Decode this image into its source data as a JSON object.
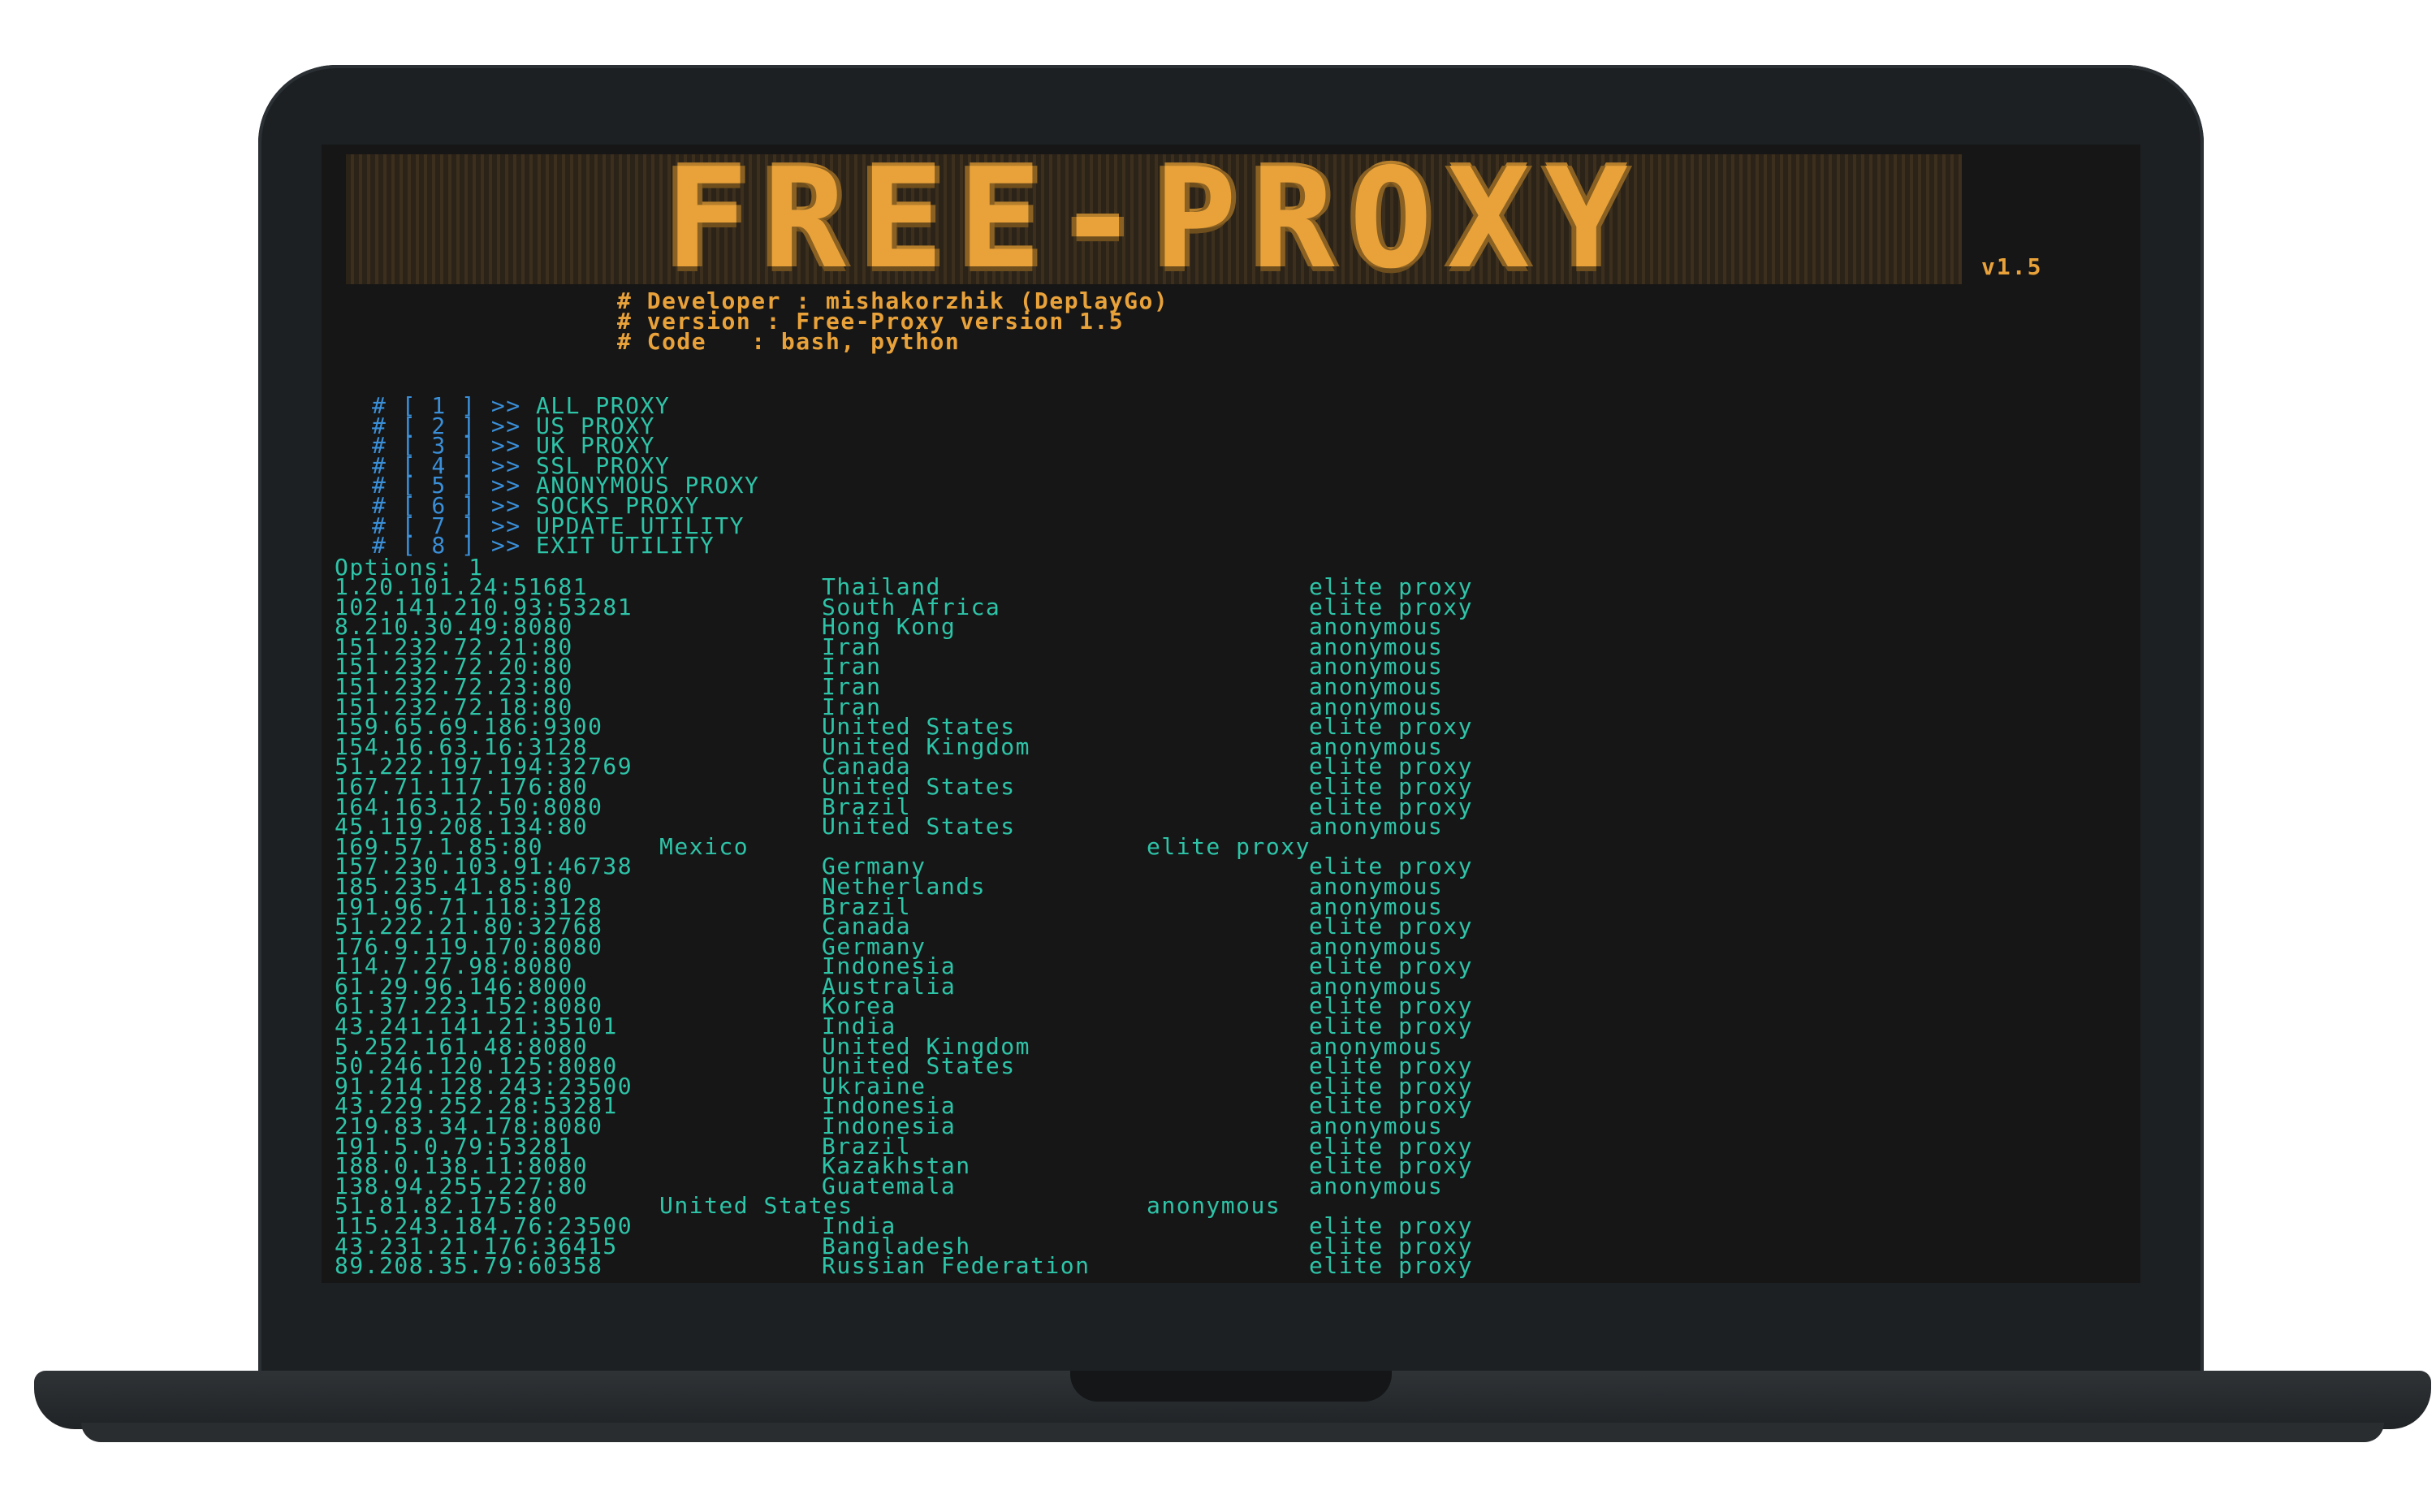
{
  "banner": {
    "title": "FREE-PROXY",
    "version_tag": "v1.5"
  },
  "info": {
    "developer": "# Developer : mishakorzhik (DeplayGo)",
    "version": "# version : Free-Proxy version 1.5",
    "code": "# Code   : bash, python"
  },
  "menu": [
    {
      "hash": "#",
      "num": "[ 1 ]",
      "arrow": ">>",
      "label": "ALL PROXY"
    },
    {
      "hash": "#",
      "num": "[ 2 ]",
      "arrow": ">>",
      "label": "US PROXY"
    },
    {
      "hash": "#",
      "num": "[ 3 ]",
      "arrow": ">>",
      "label": "UK PROXY"
    },
    {
      "hash": "#",
      "num": "[ 4 ]",
      "arrow": ">>",
      "label": "SSL PROXY"
    },
    {
      "hash": "#",
      "num": "[ 5 ]",
      "arrow": ">>",
      "label": "ANONYMOUS PROXY"
    },
    {
      "hash": "#",
      "num": "[ 6 ]",
      "arrow": ">>",
      "label": "SOCKS PROXY"
    },
    {
      "hash": "#",
      "num": "[ 7 ]",
      "arrow": ">>",
      "label": "UPDATE UTILITY"
    },
    {
      "hash": "#",
      "num": "[ 8 ]",
      "arrow": ">>",
      "label": "EXIT UTILITY"
    }
  ],
  "prompt": "Options: 1",
  "proxies": [
    {
      "ip": "1.20.101.24:51681",
      "country": "Thailand",
      "type": "elite proxy"
    },
    {
      "ip": "102.141.210.93:53281",
      "country": "South Africa",
      "type": "elite proxy"
    },
    {
      "ip": "8.210.30.49:8080",
      "country": "Hong Kong",
      "type": "anonymous"
    },
    {
      "ip": "151.232.72.21:80",
      "country": "Iran",
      "type": "anonymous"
    },
    {
      "ip": "151.232.72.20:80",
      "country": "Iran",
      "type": "anonymous"
    },
    {
      "ip": "151.232.72.23:80",
      "country": "Iran",
      "type": "anonymous"
    },
    {
      "ip": "151.232.72.18:80",
      "country": "Iran",
      "type": "anonymous"
    },
    {
      "ip": "159.65.69.186:9300",
      "country": "United States",
      "type": "elite proxy"
    },
    {
      "ip": "154.16.63.16:3128",
      "country": "United Kingdom",
      "type": "anonymous"
    },
    {
      "ip": "51.222.197.194:32769",
      "country": "Canada",
      "type": "elite proxy"
    },
    {
      "ip": "167.71.117.176:80",
      "country": "United States",
      "type": "elite proxy"
    },
    {
      "ip": "164.163.12.50:8080",
      "country": "Brazil",
      "type": "elite proxy"
    },
    {
      "ip": "45.119.208.134:80",
      "country": "United States",
      "type": "anonymous"
    },
    {
      "ip": "169.57.1.85:80",
      "country": "Mexico",
      "type": "elite proxy",
      "alt": true
    },
    {
      "ip": "157.230.103.91:46738",
      "country": "Germany",
      "type": "elite proxy"
    },
    {
      "ip": "185.235.41.85:80",
      "country": "Netherlands",
      "type": "anonymous"
    },
    {
      "ip": "191.96.71.118:3128",
      "country": "Brazil",
      "type": "anonymous"
    },
    {
      "ip": "51.222.21.80:32768",
      "country": "Canada",
      "type": "elite proxy"
    },
    {
      "ip": "176.9.119.170:8080",
      "country": "Germany",
      "type": "anonymous"
    },
    {
      "ip": "114.7.27.98:8080",
      "country": "Indonesia",
      "type": "elite proxy"
    },
    {
      "ip": "61.29.96.146:8000",
      "country": "Australia",
      "type": "anonymous"
    },
    {
      "ip": "61.37.223.152:8080",
      "country": "Korea",
      "type": "elite proxy"
    },
    {
      "ip": "43.241.141.21:35101",
      "country": "India",
      "type": "elite proxy"
    },
    {
      "ip": "5.252.161.48:8080",
      "country": "United Kingdom",
      "type": "anonymous"
    },
    {
      "ip": "50.246.120.125:8080",
      "country": "United States",
      "type": "elite proxy"
    },
    {
      "ip": "91.214.128.243:23500",
      "country": "Ukraine",
      "type": "elite proxy"
    },
    {
      "ip": "43.229.252.28:53281",
      "country": "Indonesia",
      "type": "elite proxy"
    },
    {
      "ip": "219.83.34.178:8080",
      "country": "Indonesia",
      "type": "anonymous"
    },
    {
      "ip": "191.5.0.79:53281",
      "country": "Brazil",
      "type": "elite proxy"
    },
    {
      "ip": "188.0.138.11:8080",
      "country": "Kazakhstan",
      "type": "elite proxy"
    },
    {
      "ip": "138.94.255.227:80",
      "country": "Guatemala",
      "type": "anonymous"
    },
    {
      "ip": "51.81.82.175:80",
      "country": "United States",
      "type": "anonymous",
      "alt": true
    },
    {
      "ip": "115.243.184.76:23500",
      "country": "India",
      "type": "elite proxy"
    },
    {
      "ip": "43.231.21.176:36415",
      "country": "Bangladesh",
      "type": "elite proxy"
    },
    {
      "ip": "89.208.35.79:60358",
      "country": "Russian Federation",
      "type": "elite proxy"
    }
  ],
  "colors": {
    "banner": "#e9a23a",
    "menu_marker": "#3a8fd8",
    "terminal_text": "#2ec4a8",
    "screen_bg": "#161616",
    "laptop_body": "#1c2023"
  }
}
